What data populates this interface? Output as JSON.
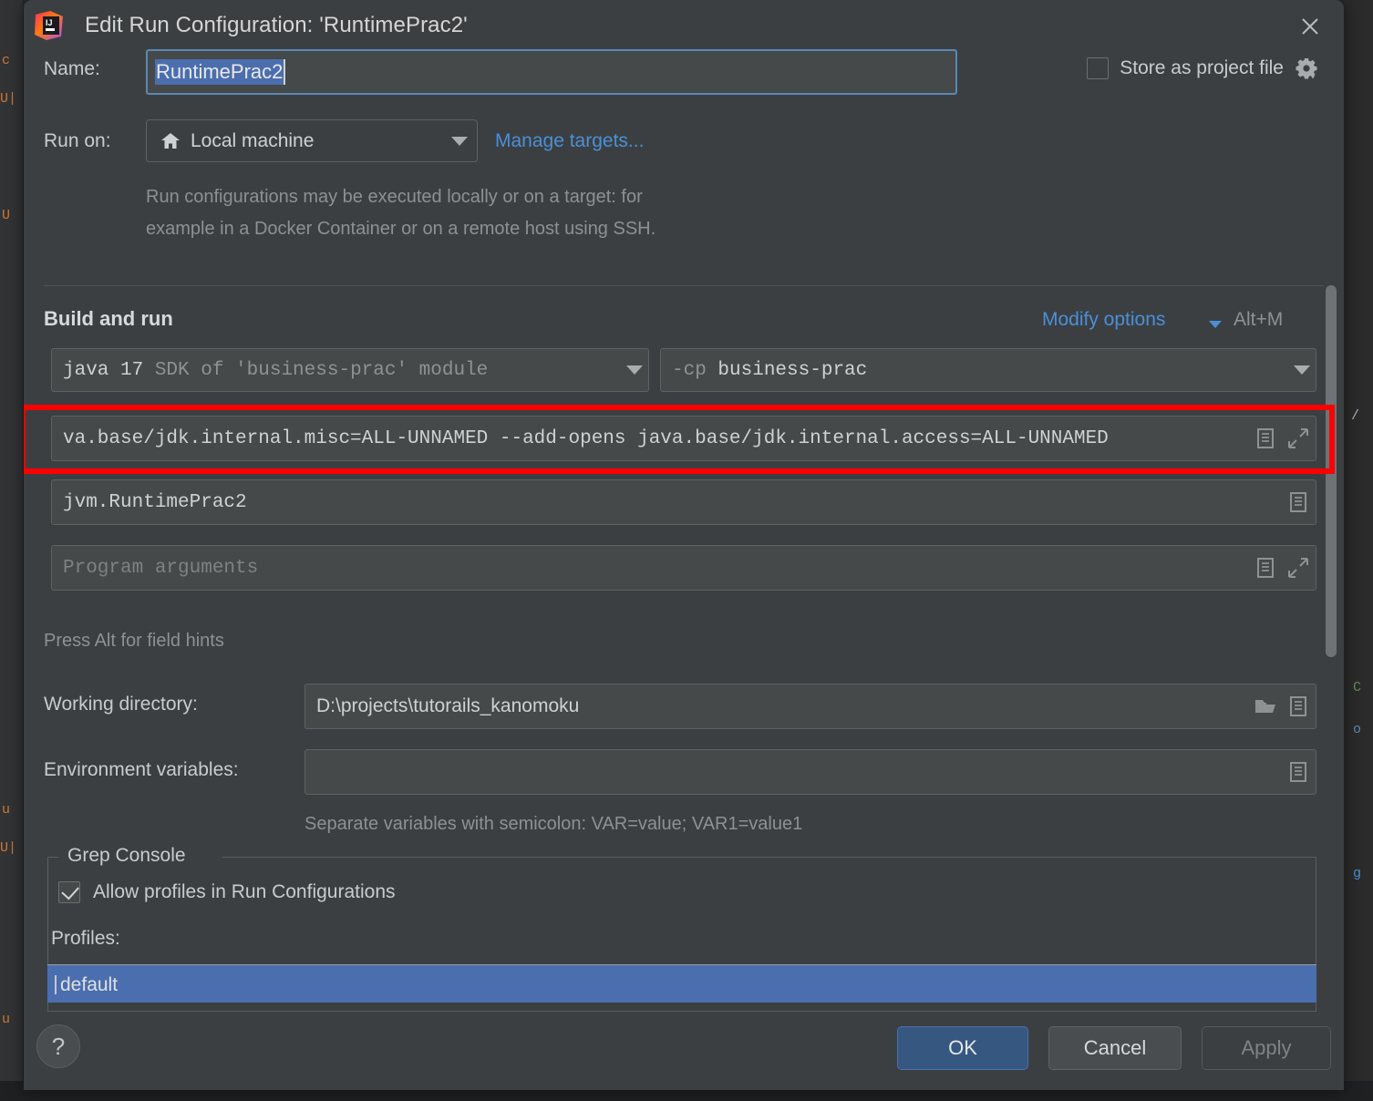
{
  "background": {
    "left_gutter_lines": [
      "c",
      "U|",
      "U",
      "u",
      "U|",
      "u"
    ],
    "right_pane_lines": [
      "/",
      "C",
      "o",
      "g"
    ],
    "bottom_bar": ""
  },
  "dialog": {
    "icon": "intellij-idea-icon",
    "title": "Edit Run Configuration: 'RuntimePrac2'",
    "close_icon": "close-icon"
  },
  "name_row": {
    "label": "Name:",
    "value": "RuntimePrac2"
  },
  "store_as_project_file": {
    "label": "Store as project file",
    "checked": false,
    "gear_icon": "gear-icon"
  },
  "run_on": {
    "label": "Run on:",
    "value": "Local machine",
    "icon": "home-icon",
    "manage_targets_link": "Manage targets...",
    "description_line1": "Run configurations may be executed locally or on a target: for",
    "description_line2": "example in a Docker Container or on a remote host using SSH."
  },
  "build_and_run": {
    "section_title": "Build and run",
    "modify_options_link": "Modify options",
    "modify_options_shortcut": "Alt+M",
    "sdk": {
      "value": "java 17",
      "hint": "SDK of 'business-prac' module"
    },
    "classpath": {
      "prefix": "-cp",
      "value": "business-prac"
    },
    "vm_options": {
      "value": "va.base/jdk.internal.misc=ALL-UNNAMED --add-opens java.base/jdk.internal.access=ALL-UNNAMED",
      "icons": [
        "macro-icon",
        "expand-icon"
      ]
    },
    "main_class": {
      "value": "jvm.RuntimePrac2",
      "icons": [
        "macro-icon"
      ]
    },
    "program_arguments": {
      "placeholder": "Program arguments",
      "icons": [
        "macro-icon",
        "expand-icon"
      ]
    },
    "field_hint": "Press Alt for field hints"
  },
  "working_directory": {
    "label": "Working directory:",
    "value": "D:\\projects\\tutorails_kanomoku",
    "icons": [
      "folder-icon",
      "macro-icon"
    ]
  },
  "environment_variables": {
    "label": "Environment variables:",
    "value": "",
    "hint": "Separate variables with semicolon: VAR=value; VAR1=value1",
    "icons": [
      "macro-icon"
    ]
  },
  "grep_console": {
    "legend": "Grep Console",
    "allow_profiles_label": "Allow profiles in Run Configurations",
    "allow_profiles_checked": true,
    "profiles_label": "Profiles:",
    "profiles": [
      {
        "name": "default",
        "selected": true
      }
    ]
  },
  "buttons": {
    "help": "?",
    "ok": "OK",
    "cancel": "Cancel",
    "apply": "Apply"
  },
  "colors": {
    "dialog_bg": "#3c3f41",
    "field_bg": "#45494a",
    "accent_link": "#4a90d9",
    "selection_blue": "#4b6eaf",
    "ok_button": "#365880",
    "highlight_red": "#fe0000",
    "text_primary": "#cfd2d4",
    "text_dim": "#8d9194"
  },
  "annotation": {
    "highlight_target": "vm-options-field",
    "highlight_color": "#fe0000"
  }
}
